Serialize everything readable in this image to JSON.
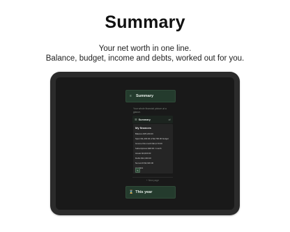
{
  "hero": {
    "title": "Summary",
    "subtitle_line1": "Your net worth in one line.",
    "subtitle_line2": "Balance, budget, income and debts, worked out for you."
  },
  "app": {
    "header_title": "Summary",
    "description": "Your whole financial picture at a glance.",
    "card_title": "Summary",
    "panel": {
      "title": "My finances",
      "lines": [
        "Balance $78,240.00",
        "Spent $1,230.94 of $2,700.00 budget",
        "Income this month $12,170.00",
        "Subscriptions $48.00 / month",
        "Assets $4,620.00",
        "Debts $12,340.00",
        "Net worth $4,620.00",
        "4 wallets"
      ],
      "action_icon": "edit-icon"
    },
    "new_page_label": "+ New page",
    "section_title": "This year"
  },
  "colors": {
    "accent": "#243b2d",
    "screen_bg": "#191919",
    "tablet_frame": "#2b2b2b"
  }
}
